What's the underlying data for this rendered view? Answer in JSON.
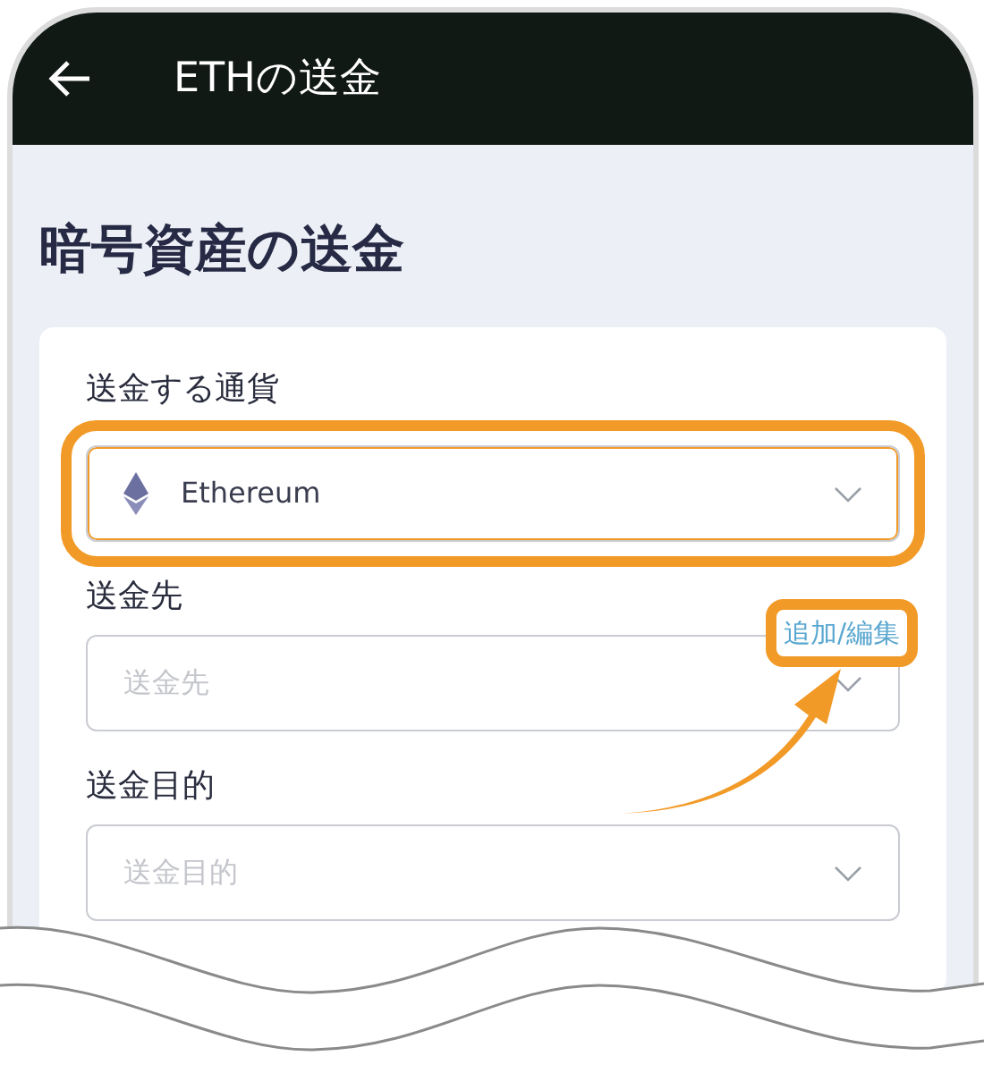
{
  "header": {
    "title": "ETHの送金"
  },
  "page_title": "暗号資産の送金",
  "fields": [
    {
      "label": "送金する通貨",
      "kind": "select",
      "value": "Ethereum",
      "highlighted": true
    },
    {
      "label": "送金先",
      "kind": "select",
      "placeholder": "送金先",
      "highlighted": false,
      "action": {
        "label": "追加/編集",
        "highlighted": true
      }
    },
    {
      "label": "送金目的",
      "kind": "select",
      "placeholder": "送金目的",
      "highlighted": false
    }
  ]
}
